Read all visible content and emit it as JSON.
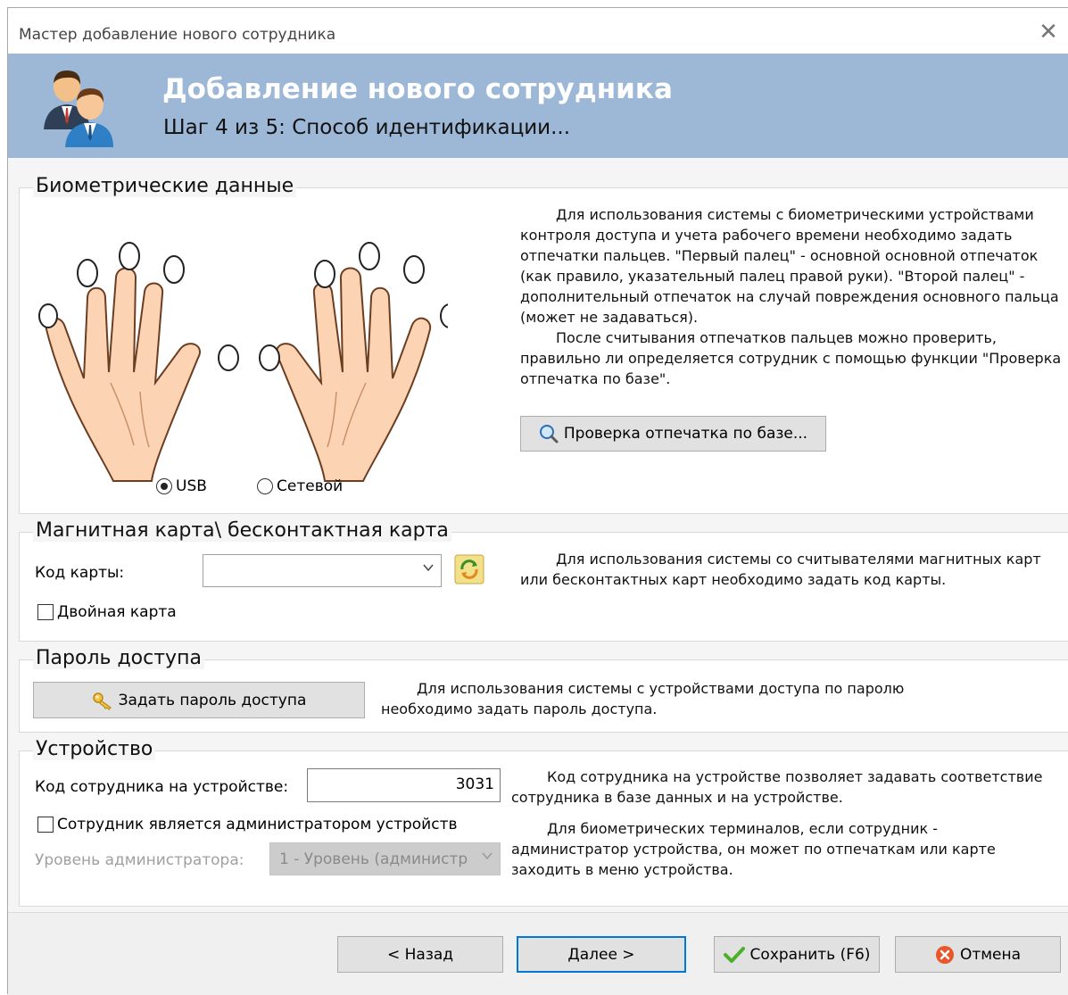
{
  "window": {
    "title": "Мастер добавление нового сотрудника",
    "close_symbol": "✕"
  },
  "banner": {
    "title": "Добавление нового сотрудника",
    "subtitle": "Шаг 4 из 5: Способ идентификации...",
    "icon": "users-icon"
  },
  "biometric": {
    "title": "Биометрические данные",
    "desc_p1": "Для использования системы с биометрическими устройствами контроля доступа и учета рабочего времени необходимо задать отпечатки пальцев. \"Первый палец\" - основной основной отпечаток (как правило, указательный палец правой руки). \"Второй палец\"  - дополнительный отпечаток на случай повреждения основного пальца (может не задаваться).",
    "desc_p2": "После считывания отпечатков пальцев можно проверить, правильно ли определяется сотрудник с помощью функции \"Проверка отпечатка по базе\".",
    "check_button": "Проверка отпечатка по базе...",
    "radio_usb": "USB",
    "radio_network": "Сетевой",
    "selected_mode": "USB"
  },
  "card": {
    "title": "Магнитная карта\\ бесконтактная карта",
    "code_label": "Код карты:",
    "code_value": "",
    "double_card_label": "Двойная карта",
    "double_card_checked": false,
    "desc": "Для использования системы со считывателями магнитных карт или бесконтактных карт необходимо задать код карты."
  },
  "password": {
    "title": "Пароль доступа",
    "button": "Задать пароль доступа",
    "desc": "Для использования системы с устройствами доступа по паролю необходимо задать пароль доступа."
  },
  "device": {
    "title": "Устройство",
    "code_label": "Код сотрудника на устройстве:",
    "code_value": "3031",
    "admin_label": "Сотрудник является администратором устройств",
    "admin_checked": false,
    "level_label": "Уровень администратора:",
    "level_value": "1 - Уровень (администр",
    "desc_p1": "Код сотрудника на устройстве позволяет задавать соответствие сотрудника в базе данных и на устройстве.",
    "desc_p2": "Для биометрических терминалов, если сотрудник - администратор устройства, он может по отпечаткам или карте заходить в меню устройства."
  },
  "footer": {
    "back": "< Назад",
    "next": "Далее >",
    "save": "Сохранить (F6)",
    "cancel": "Отмена"
  },
  "colors": {
    "banner": "#9db8d6",
    "skin": "#fcd4b4",
    "focus": "#0078d7"
  }
}
